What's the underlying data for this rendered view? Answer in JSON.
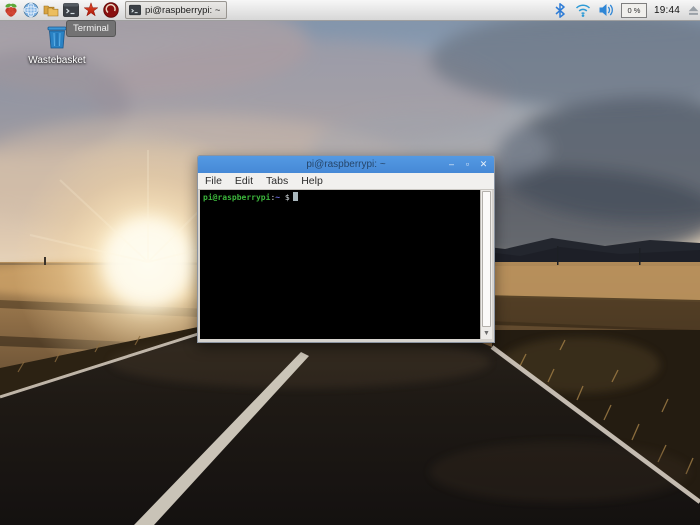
{
  "taskbar": {
    "launchers": [
      {
        "name": "menu",
        "icon": "raspberry-icon"
      },
      {
        "name": "web-browser",
        "icon": "globe-icon"
      },
      {
        "name": "file-manager",
        "icon": "folders-icon"
      },
      {
        "name": "terminal",
        "icon": "terminal-icon"
      },
      {
        "name": "mathematica",
        "icon": "mathematica-star-icon"
      },
      {
        "name": "wolfram",
        "icon": "wolfram-icon"
      }
    ],
    "window_button": {
      "icon": "terminal-icon",
      "label": "pi@raspberrypi: ~"
    },
    "tray": {
      "icons": [
        "bluetooth-icon",
        "wifi-icon",
        "volume-icon"
      ],
      "cpu_label": "0 %",
      "clock": "19:44",
      "eject_icon": "eject-icon"
    }
  },
  "tooltip": {
    "text": "Terminal"
  },
  "desktop": {
    "wastebasket": {
      "icon": "wastebasket-icon",
      "label": "Wastebasket"
    }
  },
  "window": {
    "title": "pi@raspberrypi: ~",
    "controls": [
      {
        "name": "minimize",
        "glyph": "–"
      },
      {
        "name": "maximize",
        "glyph": "▫"
      },
      {
        "name": "close",
        "glyph": "✕"
      }
    ],
    "menu": [
      {
        "label": "File"
      },
      {
        "label": "Edit"
      },
      {
        "label": "Tabs"
      },
      {
        "label": "Help"
      }
    ],
    "terminal": {
      "prompt": {
        "user_host": "pi@raspberrypi",
        "separator": ":",
        "path": "~",
        "symbol": "$"
      }
    }
  },
  "colors": {
    "titlebar_blue": "#4b92df",
    "prompt_green": "#3bb53b",
    "prompt_path_blue": "#7070e8",
    "taskbar_bg": "#e9e9e9",
    "tray_icon_blue": "#2e86d6",
    "tooltip_bg": "#707070",
    "terminal_bg": "#000000"
  }
}
